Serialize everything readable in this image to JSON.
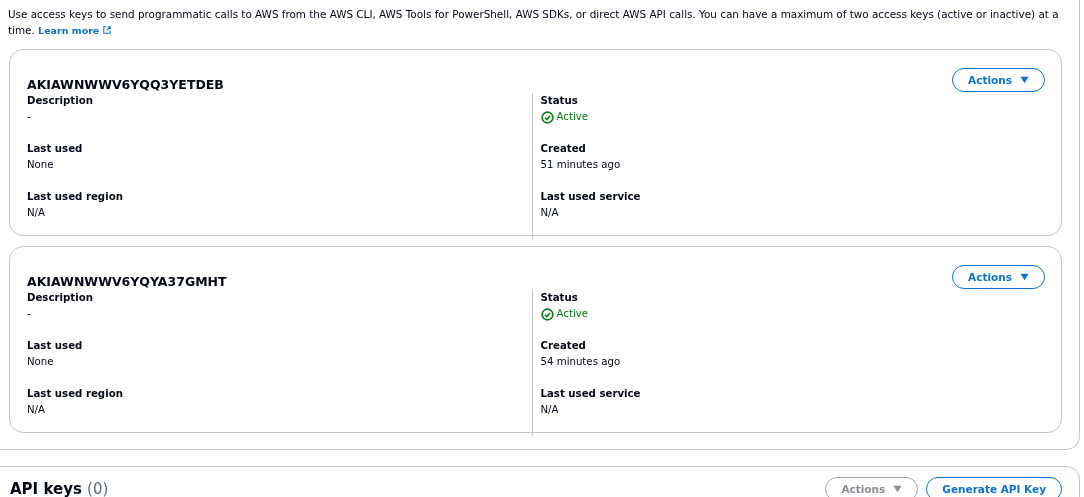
{
  "intro": {
    "text": "Use access keys to send programmatic calls to AWS from the AWS CLI, AWS Tools for PowerShell, AWS SDKs, or direct AWS API calls. You can have a maximum of two access keys (active or inactive) at a time.",
    "link": "Learn more"
  },
  "access_keys": [
    {
      "id": "AKIAWNWWV6YQQ3YETDEB",
      "actions": {
        "label": "Actions",
        "disabled": false
      },
      "left": [
        {
          "label": "Description",
          "value": "-"
        },
        {
          "label": "Last used",
          "value": "None"
        },
        {
          "label": "Last used region",
          "value": "N/A"
        }
      ],
      "right": [
        {
          "label": "Status",
          "value": "Active",
          "kind": "success"
        },
        {
          "label": "Created",
          "value": "51 minutes ago"
        },
        {
          "label": "Last used service",
          "value": "N/A"
        }
      ]
    },
    {
      "id": "AKIAWNWWV6YQYA37GMHT",
      "actions": {
        "label": "Actions",
        "disabled": false
      },
      "left": [
        {
          "label": "Description",
          "value": "-"
        },
        {
          "label": "Last used",
          "value": "None"
        },
        {
          "label": "Last used region",
          "value": "N/A"
        }
      ],
      "right": [
        {
          "label": "Status",
          "value": "Active",
          "kind": "success"
        },
        {
          "label": "Created",
          "value": "54 minutes ago"
        },
        {
          "label": "Last used service",
          "value": "N/A"
        }
      ]
    }
  ],
  "api_keys": {
    "title": "API keys",
    "count": "(0)",
    "actions": {
      "label": "Actions",
      "disabled": true
    },
    "generate": "Generate API Key"
  }
}
